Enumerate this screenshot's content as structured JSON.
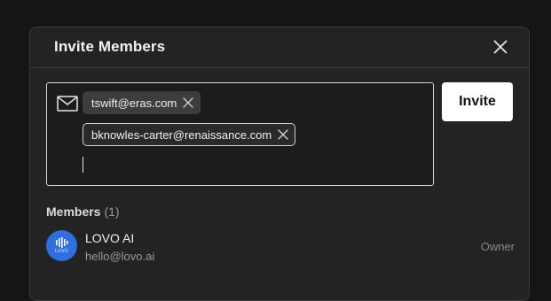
{
  "dialog": {
    "title": "Invite Members"
  },
  "invite": {
    "chips": [
      {
        "email": "tswift@eras.com"
      },
      {
        "email": "bknowles-carter@renaissance.com"
      }
    ],
    "button_label": "Invite"
  },
  "members": {
    "heading": "Members",
    "count": "(1)",
    "list": [
      {
        "name": "LOVO AI",
        "email": "hello@lovo.ai",
        "role": "Owner",
        "avatar_text": "LOVO",
        "avatar_color": "#2f6fe0"
      }
    ]
  },
  "icons": {
    "close": "close-icon",
    "mail": "mail-icon",
    "chip_remove": "x-icon"
  }
}
